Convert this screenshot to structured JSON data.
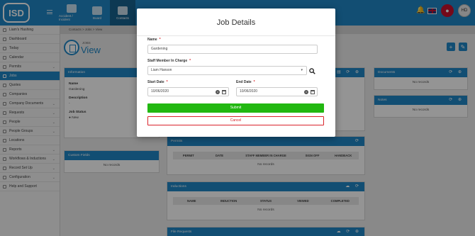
{
  "topbar": {
    "logo": "ISD",
    "nav": [
      {
        "label": "Accident / Incident"
      },
      {
        "label": "Board"
      },
      {
        "label": "Contacts"
      }
    ],
    "avatar_initials": "HD"
  },
  "breadcrumb": {
    "items": [
      "Contacts",
      "Jobs",
      "View"
    ]
  },
  "sidebar": {
    "items": [
      {
        "label": "Liam's Hashing"
      },
      {
        "label": "Dashboard"
      },
      {
        "label": "Today"
      },
      {
        "label": "Calendar"
      },
      {
        "label": "Permits",
        "chevron": "⌄"
      },
      {
        "label": "Jobs"
      },
      {
        "label": "Quotes"
      },
      {
        "label": "Companies"
      },
      {
        "label": "Company Documents",
        "chevron": "⌄"
      },
      {
        "label": "Requests",
        "chevron": "⌄"
      },
      {
        "label": "People",
        "chevron": "⌄"
      },
      {
        "label": "People Groups",
        "chevron": "⌄"
      },
      {
        "label": "Locations"
      },
      {
        "label": "Reports",
        "chevron": "⌄"
      },
      {
        "label": "Workflows & Inductions",
        "chevron": "⌄"
      },
      {
        "label": "Record Set Up",
        "chevron": "⌄"
      },
      {
        "label": "Configuration",
        "chevron": "⌄"
      },
      {
        "label": "Help and Support"
      }
    ]
  },
  "page": {
    "subtitle": "JOBS",
    "title": "View"
  },
  "info_panel": {
    "header": "Information",
    "name_label": "Name",
    "name_value": "Gardening",
    "description_label": "Description",
    "description_value": "-",
    "status_label": "Job Status",
    "status_value": "New"
  },
  "custom_fields": {
    "header": "Custom Fields",
    "empty": "No records"
  },
  "permits": {
    "header": "Permits",
    "columns": [
      "PERMIT",
      "DATE",
      "STAFF MEMBER IN CHARGE",
      "SIGN OFF",
      "HANDBACK"
    ],
    "empty": "No records"
  },
  "inductions": {
    "header": "Inductions",
    "columns": [
      "NAME",
      "INDUCTION",
      "STATUS",
      "VIEWED",
      "COMPLETED"
    ],
    "empty": "No records"
  },
  "file_requests": {
    "header": "File Requests"
  },
  "documents": {
    "header": "Documents",
    "empty": "No records"
  },
  "notes": {
    "header": "Notes",
    "empty": "No records"
  },
  "modal": {
    "title": "Job Details",
    "name_label": "Name",
    "name_value": "Gardening",
    "staff_label": "Staff Member In Charge",
    "staff_value": "Liam Hanson",
    "start_label": "Start Date",
    "start_value": "10/06/2020",
    "end_label": "End Date",
    "end_value": "10/06/2020",
    "required_mark": "*",
    "submit_label": "Submit",
    "cancel_label": "Cancel"
  },
  "colors": {
    "primary": "#1f87c6",
    "submit": "#22b811",
    "danger": "#d9242b"
  }
}
